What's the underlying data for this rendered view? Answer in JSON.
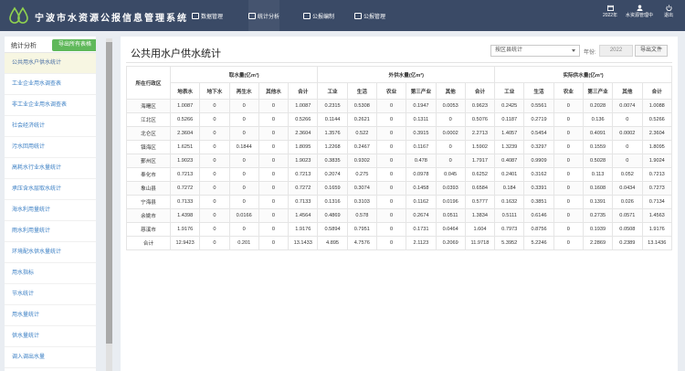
{
  "app": {
    "title": "宁波市水资源公报信息管理系统",
    "nav": [
      {
        "label": "数据管理"
      },
      {
        "label": "统计分析"
      },
      {
        "label": "公报编制"
      },
      {
        "label": "公报管理"
      }
    ],
    "year_badge": "2022年",
    "user": "水资源管理中",
    "logout": "退出"
  },
  "sidebar": {
    "title": "统计分析",
    "export_button": "导出所有表格",
    "items": [
      {
        "label": "公共用水户供水统计"
      },
      {
        "label": "工业企业用水调查表"
      },
      {
        "label": "非工业企业用水调查表"
      },
      {
        "label": "社会经济统计"
      },
      {
        "label": "污水回用统计"
      },
      {
        "label": "高耗水行业水量统计"
      },
      {
        "label": "承压含水层取水统计"
      },
      {
        "label": "海水利用量统计"
      },
      {
        "label": "雨水利用量统计"
      },
      {
        "label": "环境配水供水量统计"
      },
      {
        "label": "用水指标"
      },
      {
        "label": "节水统计"
      },
      {
        "label": "用水量统计"
      },
      {
        "label": "供水量统计"
      },
      {
        "label": "调入调出水量"
      }
    ]
  },
  "main": {
    "title": "公共用水户供水统计",
    "select_value": "按区县统计",
    "year_label": "年份:",
    "year_value": "2022",
    "file_button": "导出文件",
    "table": {
      "region_header": "所在行政区",
      "groups": [
        "取水量(亿m³)",
        "外供水量(亿m³)",
        "实际供水量(亿m³)"
      ],
      "sub_headers": [
        "地表水",
        "地下水",
        "再生水",
        "其他水",
        "合计",
        "工业",
        "生活",
        "农业",
        "第三产业",
        "其他",
        "合计",
        "工业",
        "生活",
        "农业",
        "第三产业",
        "其他",
        "合计"
      ],
      "rows": [
        {
          "region": "海曙区",
          "values": [
            "1.0087",
            "0",
            "0",
            "0",
            "1.0087",
            "0.2315",
            "0.5308",
            "0",
            "0.1947",
            "0.0053",
            "0.9623",
            "0.2425",
            "0.5561",
            "0",
            "0.2028",
            "0.0074",
            "1.0088"
          ]
        },
        {
          "region": "江北区",
          "values": [
            "0.5266",
            "0",
            "0",
            "0",
            "0.5266",
            "0.1144",
            "0.2621",
            "0",
            "0.1311",
            "0",
            "0.5076",
            "0.1187",
            "0.2719",
            "0",
            "0.136",
            "0",
            "0.5266"
          ]
        },
        {
          "region": "北仑区",
          "values": [
            "2.3604",
            "0",
            "0",
            "0",
            "2.3604",
            "1.3576",
            "0.522",
            "0",
            "0.3915",
            "0.0002",
            "2.2713",
            "1.4057",
            "0.5454",
            "0",
            "0.4091",
            "0.0002",
            "2.3604"
          ]
        },
        {
          "region": "镇海区",
          "values": [
            "1.6251",
            "0",
            "0.1844",
            "0",
            "1.8095",
            "1.2268",
            "0.2467",
            "0",
            "0.1167",
            "0",
            "1.5902",
            "1.3239",
            "0.3297",
            "0",
            "0.1559",
            "0",
            "1.8095"
          ]
        },
        {
          "region": "鄞州区",
          "values": [
            "1.9023",
            "0",
            "0",
            "0",
            "1.9023",
            "0.3835",
            "0.9302",
            "0",
            "0.478",
            "0",
            "1.7917",
            "0.4087",
            "0.9909",
            "0",
            "0.5028",
            "0",
            "1.9024"
          ]
        },
        {
          "region": "奉化市",
          "values": [
            "0.7213",
            "0",
            "0",
            "0",
            "0.7213",
            "0.2074",
            "0.275",
            "0",
            "0.0978",
            "0.045",
            "0.6252",
            "0.2401",
            "0.3162",
            "0",
            "0.113",
            "0.052",
            "0.7213"
          ]
        },
        {
          "region": "象山县",
          "values": [
            "0.7272",
            "0",
            "0",
            "0",
            "0.7272",
            "0.1659",
            "0.3074",
            "0",
            "0.1458",
            "0.0393",
            "0.6584",
            "0.184",
            "0.3391",
            "0",
            "0.1608",
            "0.0434",
            "0.7273"
          ]
        },
        {
          "region": "宁海县",
          "values": [
            "0.7133",
            "0",
            "0",
            "0",
            "0.7133",
            "0.1316",
            "0.3103",
            "0",
            "0.1162",
            "0.0196",
            "0.5777",
            "0.1632",
            "0.3851",
            "0",
            "0.1391",
            "0.026",
            "0.7134"
          ]
        },
        {
          "region": "余姚市",
          "values": [
            "1.4398",
            "0",
            "0.0166",
            "0",
            "1.4564",
            "0.4869",
            "0.578",
            "0",
            "0.2674",
            "0.0511",
            "1.3834",
            "0.5111",
            "0.6146",
            "0",
            "0.2735",
            "0.0571",
            "1.4563"
          ]
        },
        {
          "region": "慈溪市",
          "values": [
            "1.9176",
            "0",
            "0",
            "0",
            "1.9176",
            "0.5894",
            "0.7951",
            "0",
            "0.1731",
            "0.0464",
            "1.604",
            "0.7973",
            "0.8756",
            "0",
            "0.1939",
            "0.0508",
            "1.9176"
          ]
        },
        {
          "region": "合计",
          "values": [
            "12.9423",
            "0",
            "0.201",
            "0",
            "13.1433",
            "4.895",
            "4.7576",
            "0",
            "2.1123",
            "0.2069",
            "11.9718",
            "5.3952",
            "5.2246",
            "0",
            "2.2869",
            "0.2389",
            "13.1436"
          ]
        }
      ]
    }
  },
  "colors": {
    "header_bg": "#3a4a66",
    "export_green": "#5fb85a",
    "link_blue": "#3b7fc4",
    "active_item_bg": "#f7f6e2"
  }
}
